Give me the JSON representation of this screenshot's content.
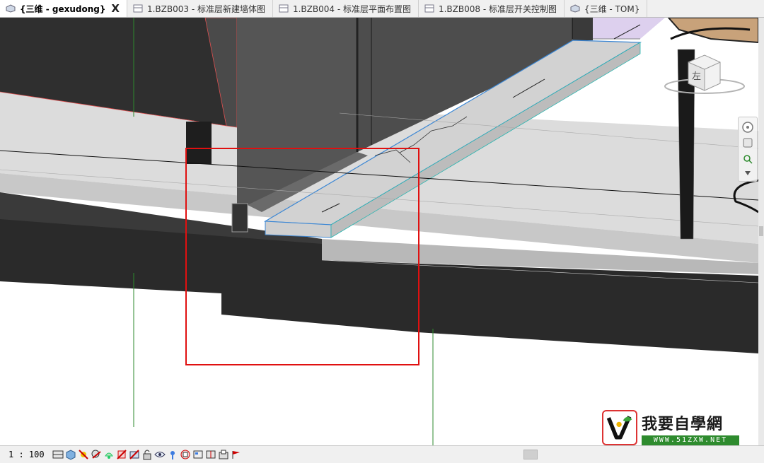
{
  "tabs": [
    {
      "label": "{三维 - gexudong}",
      "active": true,
      "icon": "3d-view-icon",
      "closable": true
    },
    {
      "label": "1.BZB003 - 标准层新建墙体图",
      "active": false,
      "icon": "floor-plan-icon"
    },
    {
      "label": "1.BZB004 - 标准层平面布置图",
      "active": false,
      "icon": "floor-plan-icon"
    },
    {
      "label": "1.BZB008 - 标准层开关控制图",
      "active": false,
      "icon": "floor-plan-icon"
    },
    {
      "label": "{三维 - TOM}",
      "active": false,
      "icon": "3d-view-icon"
    }
  ],
  "close_glyph": "X",
  "statusbar": {
    "scale": "1 : 100",
    "icons": [
      "detail-level-icon",
      "visual-style-icon",
      "sun-path-icon",
      "shadows-icon",
      "render-icon",
      "crop-view-icon",
      "show-crop-icon",
      "unlock-3d-icon",
      "temporary-hide-icon",
      "reveal-hidden-icon",
      "worksharing-icon",
      "design-options-icon",
      "analytical-model-icon",
      "highlight-displacement-icon",
      "constraints-icon"
    ]
  },
  "viewcube": {
    "face_label": "左"
  },
  "watermark": {
    "title": "我要自學網",
    "url": "WWW.51ZXW.NET"
  },
  "colors": {
    "selection_box": "#e01010",
    "edge_highlight": "#3a86d4",
    "teal_edge": "#2ab5b0",
    "dark_fill": "#2a2a2a",
    "floor_fill": "#dcdcdc"
  }
}
